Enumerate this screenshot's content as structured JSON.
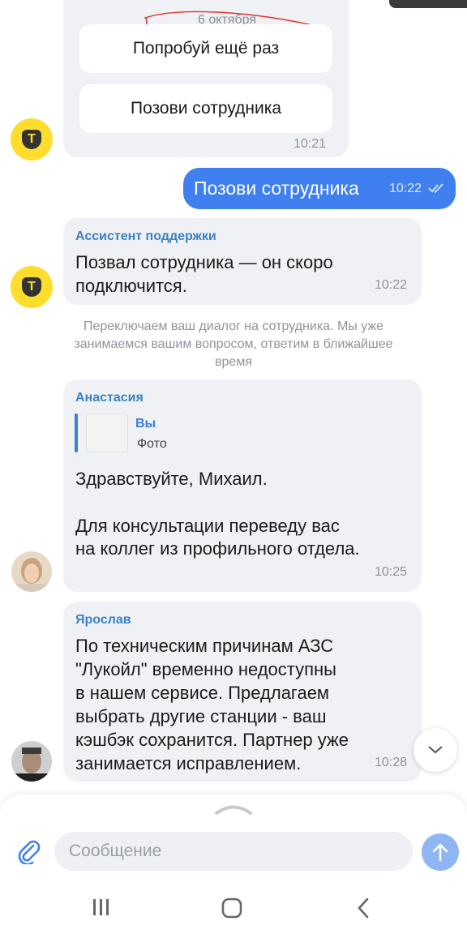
{
  "date_separator": "6 октября",
  "bot_buttons": [
    "Попробуй ещё раз",
    "Позови сотрудника"
  ],
  "bot_buttons_time": "10:21",
  "outgoing": {
    "text": "Позови сотрудника",
    "time": "10:22"
  },
  "assistant_msg": {
    "sender": "Ассистент поддержки",
    "lines": [
      "Позвал сотрудника — он скоро",
      "подключится."
    ],
    "time": "10:22"
  },
  "system_notice": [
    "Переключаем ваш диалог на сотрудника. Мы уже",
    "занимаемся вашим вопросом, ответим в ближайшее",
    "время"
  ],
  "anastasia_msg": {
    "sender": "Анастасия",
    "quote_name": "Вы",
    "quote_sub": "Фото",
    "lines": [
      "Здравствуйте, Михаил.",
      "",
      "Для консультации переведу вас",
      "на коллег из профильного отдела."
    ],
    "time": "10:25"
  },
  "yaroslav_msg": {
    "sender": "Ярослав",
    "lines": [
      "По техническим причинам АЗС",
      "\"Лукойл\" временно недоступны",
      "в нашем сервисе. Предлагаем",
      "выбрать другие станции - ваш",
      "кэшбэк сохранится. Партнер уже",
      "занимается исправлением."
    ],
    "time": "10:28"
  },
  "composer": {
    "placeholder": "Сообщение"
  },
  "colors": {
    "accent": "#3f7ff0",
    "bubble": "#eff1f4",
    "sender": "#3b82c4",
    "logo": "#ffdd2d"
  },
  "icons": [
    "paperclip-icon",
    "send-arrow-icon",
    "chevron-down-icon",
    "chevron-up-handle-icon",
    "recents-icon",
    "home-icon",
    "back-icon"
  ]
}
